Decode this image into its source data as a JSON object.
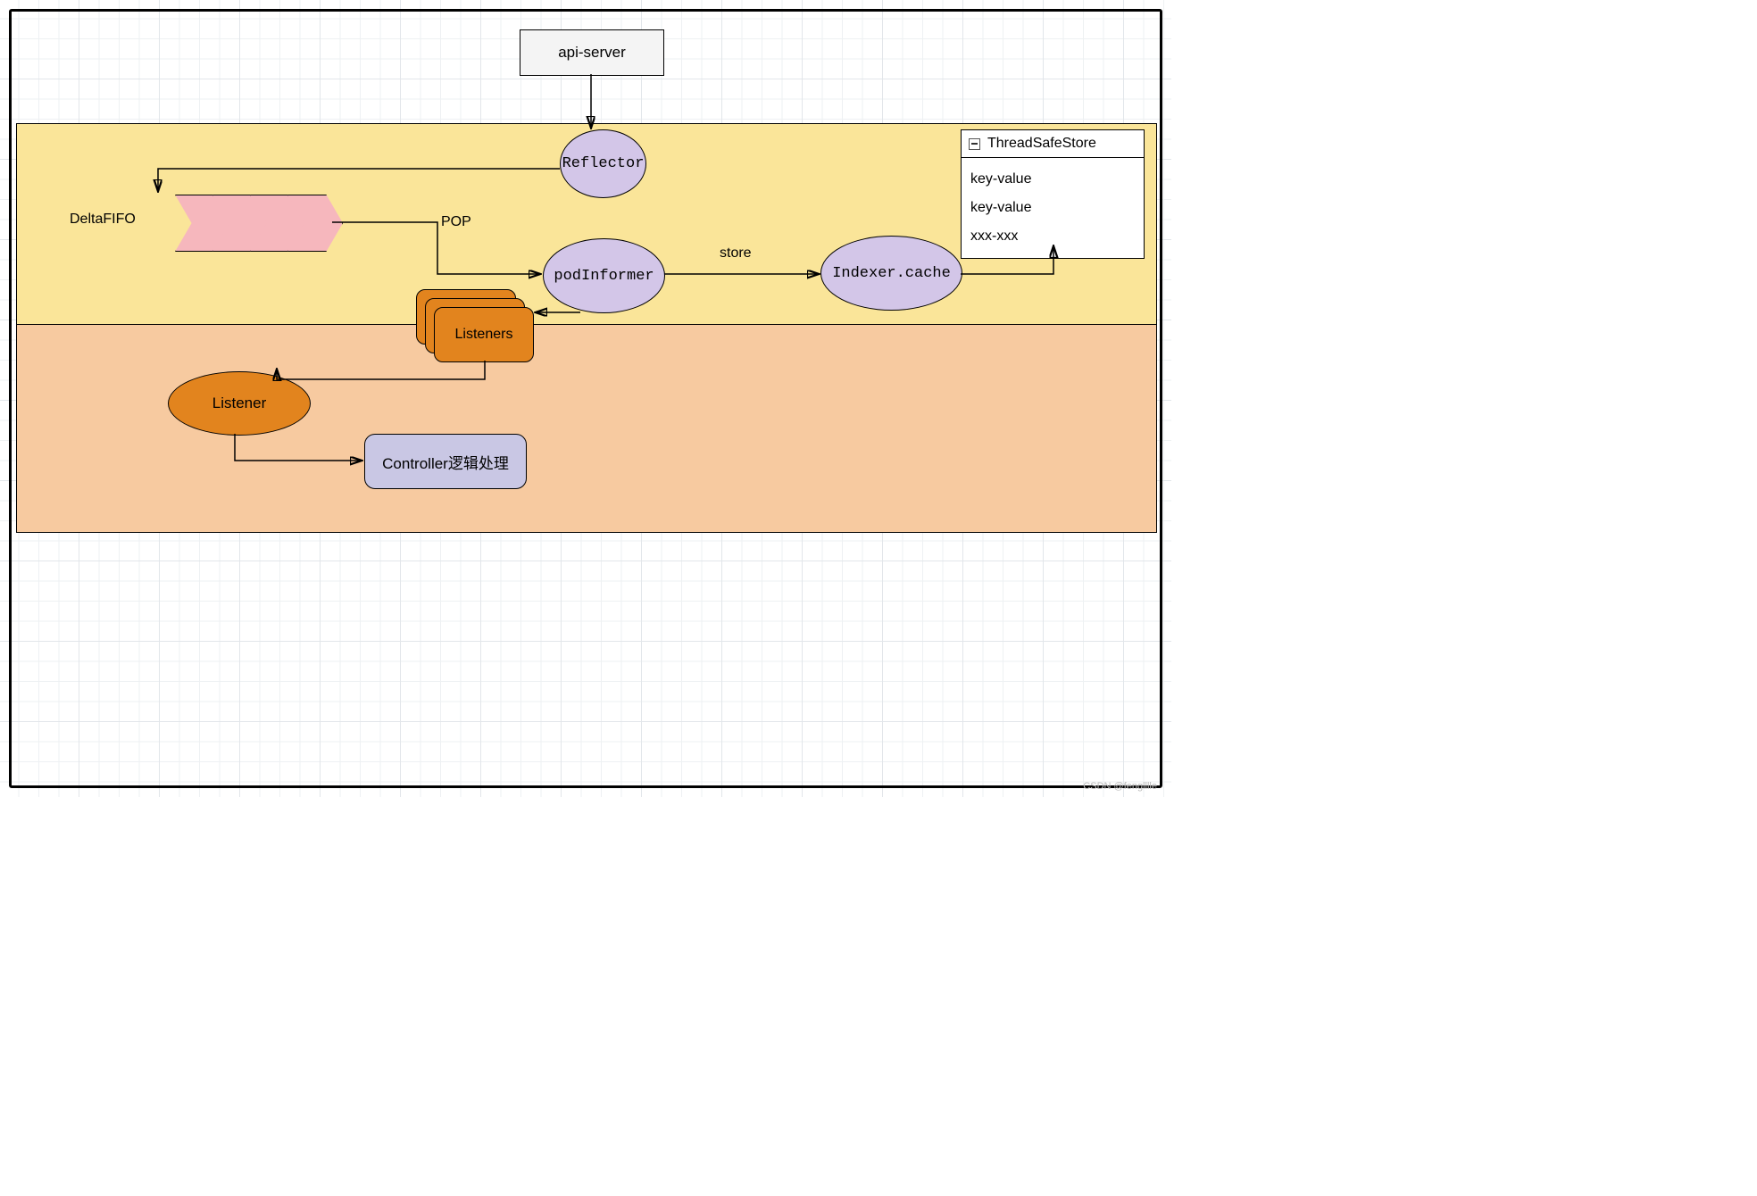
{
  "nodes": {
    "api_server": "api-server",
    "reflector": "Reflector",
    "delta_fifo": "DeltaFIFO",
    "pop": "POP",
    "pod_informer": "podInformer",
    "store": "store",
    "indexer_cache": "Indexer.cache",
    "listeners": "Listeners",
    "listener": "Listener",
    "controller": "Controller逻辑处理",
    "thread_safe_store": {
      "title": "ThreadSafeStore",
      "rows": [
        "key-value",
        "key-value",
        "xxx-xxx"
      ]
    }
  },
  "watermark": "CSDN @fenglllle"
}
